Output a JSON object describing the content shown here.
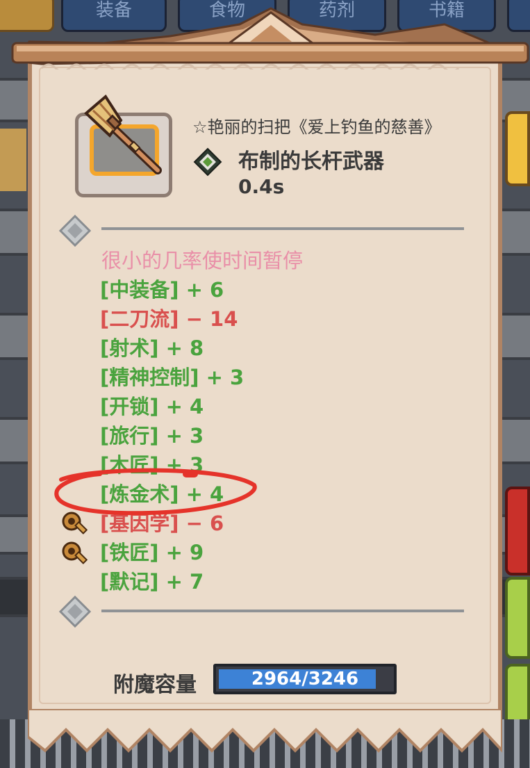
{
  "background_tabs": [
    "装备",
    "食物",
    "药剂",
    "书籍"
  ],
  "item": {
    "title": "☆艳丽的扫把《爱上钓鱼的慈善》",
    "type": "布制的长杆武器",
    "speed": "0.4s"
  },
  "effect": "很小的几率使时间暂停",
  "stats": [
    {
      "name": "[中装备]",
      "value": "+ 6",
      "kind": "pos"
    },
    {
      "name": "[二刀流]",
      "value": "− 14",
      "kind": "neg"
    },
    {
      "name": "[射术]",
      "value": "+ 8",
      "kind": "pos"
    },
    {
      "name": "[精神控制]",
      "value": "+ 3",
      "kind": "pos"
    },
    {
      "name": "[开锁]",
      "value": "+ 4",
      "kind": "pos"
    },
    {
      "name": "[旅行]",
      "value": "+ 3",
      "kind": "pos"
    },
    {
      "name": "[木匠]",
      "value": "+ 3",
      "kind": "pos"
    },
    {
      "name": "[炼金术]",
      "value": "+ 4",
      "kind": "pos"
    },
    {
      "name": "[基因学]",
      "value": "− 6",
      "kind": "neg"
    },
    {
      "name": "[铁匠]",
      "value": "+ 9",
      "kind": "pos"
    },
    {
      "name": "[默记]",
      "value": "+ 7",
      "kind": "pos"
    }
  ],
  "enchant": {
    "label": "附魔容量",
    "value_text": "2964/3246",
    "current": 2964,
    "max": 3246
  },
  "colors": {
    "positive": "#4aa33e",
    "negative": "#d9504e",
    "effect": "#e98fa8",
    "bar_fill": "#3d82d6",
    "annotation": "#e5332a"
  },
  "icons": {
    "type": "green-diamond-icon",
    "separator": "diamond-icon",
    "gear": "hammer-gear-icon"
  }
}
